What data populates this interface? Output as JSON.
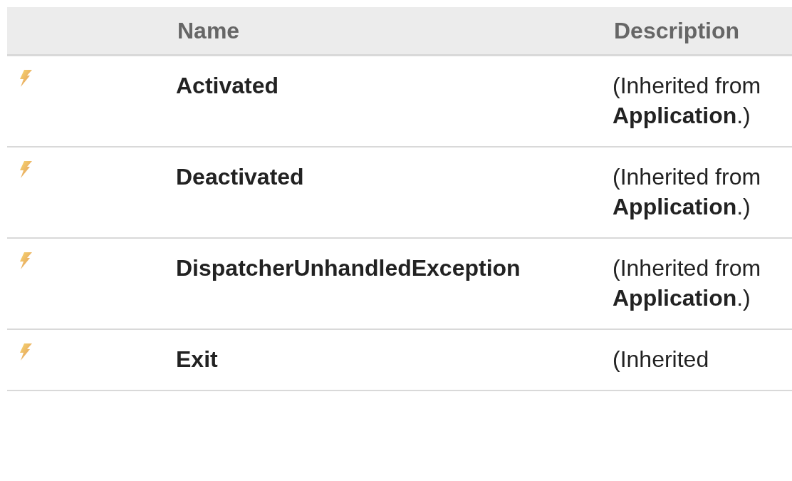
{
  "table": {
    "columns": [
      "Name",
      "Description"
    ],
    "rows": [
      {
        "name": "Activated",
        "description": "(Inherited from **Application**.)"
      },
      {
        "name": "Deactivated",
        "description": "(Inherited from **Application**.)"
      },
      {
        "name": "DispatcherUnhandledException",
        "description": "(Inherited from **Application**.)"
      },
      {
        "name": "Exit",
        "description": "(Inherited"
      }
    ]
  }
}
